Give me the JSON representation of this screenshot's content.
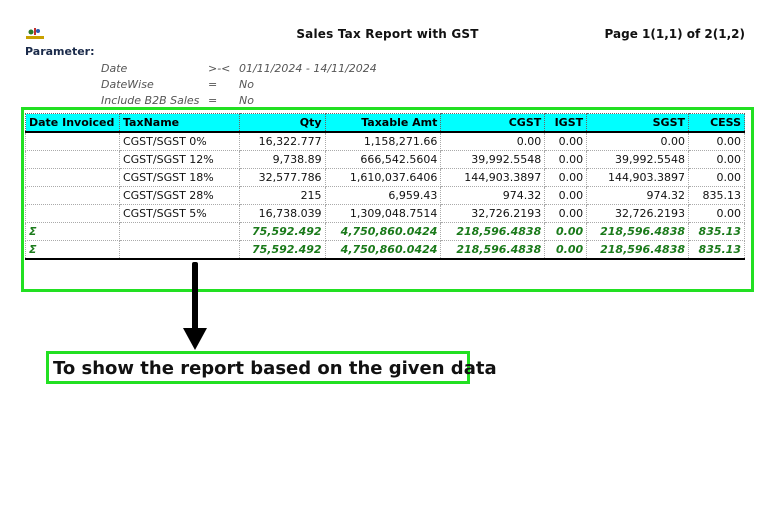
{
  "header": {
    "title": "Sales Tax Report with GST",
    "page": "Page 1(1,1) of 2(1,2)",
    "parameter_label": "Parameter:"
  },
  "parameters": [
    {
      "label": "Date",
      "op": ">-<",
      "value": "01/11/2024 - 14/11/2024"
    },
    {
      "label": "DateWise",
      "op": "=",
      "value": "No"
    },
    {
      "label": "Include B2B Sales",
      "op": "=",
      "value": "No"
    }
  ],
  "table": {
    "columns": [
      "Date Invoiced",
      "TaxName",
      "Qty",
      "Taxable Amt",
      "CGST",
      "IGST",
      "SGST",
      "CESS"
    ],
    "rows": [
      [
        "",
        "CGST/SGST 0%",
        "16,322.777",
        "1,158,271.66",
        "0.00",
        "0.00",
        "0.00",
        "0.00"
      ],
      [
        "",
        "CGST/SGST 12%",
        "9,738.89",
        "666,542.5604",
        "39,992.5548",
        "0.00",
        "39,992.5548",
        "0.00"
      ],
      [
        "",
        "CGST/SGST 18%",
        "32,577.786",
        "1,610,037.6406",
        "144,903.3897",
        "0.00",
        "144,903.3897",
        "0.00"
      ],
      [
        "",
        "CGST/SGST 28%",
        "215",
        "6,959.43",
        "974.32",
        "0.00",
        "974.32",
        "835.13"
      ],
      [
        "",
        "CGST/SGST 5%",
        "16,738.039",
        "1,309,048.7514",
        "32,726.2193",
        "0.00",
        "32,726.2193",
        "0.00"
      ]
    ],
    "sums": [
      [
        "Σ",
        "",
        "75,592.492",
        "4,750,860.0424",
        "218,596.4838",
        "0.00",
        "218,596.4838",
        "835.13"
      ],
      [
        "Σ",
        "",
        "75,592.492",
        "4,750,860.0424",
        "218,596.4838",
        "0.00",
        "218,596.4838",
        "835.13"
      ]
    ]
  },
  "annotation": {
    "caption": "To show the report based on the given data",
    "highlight_color": "#22e022"
  }
}
